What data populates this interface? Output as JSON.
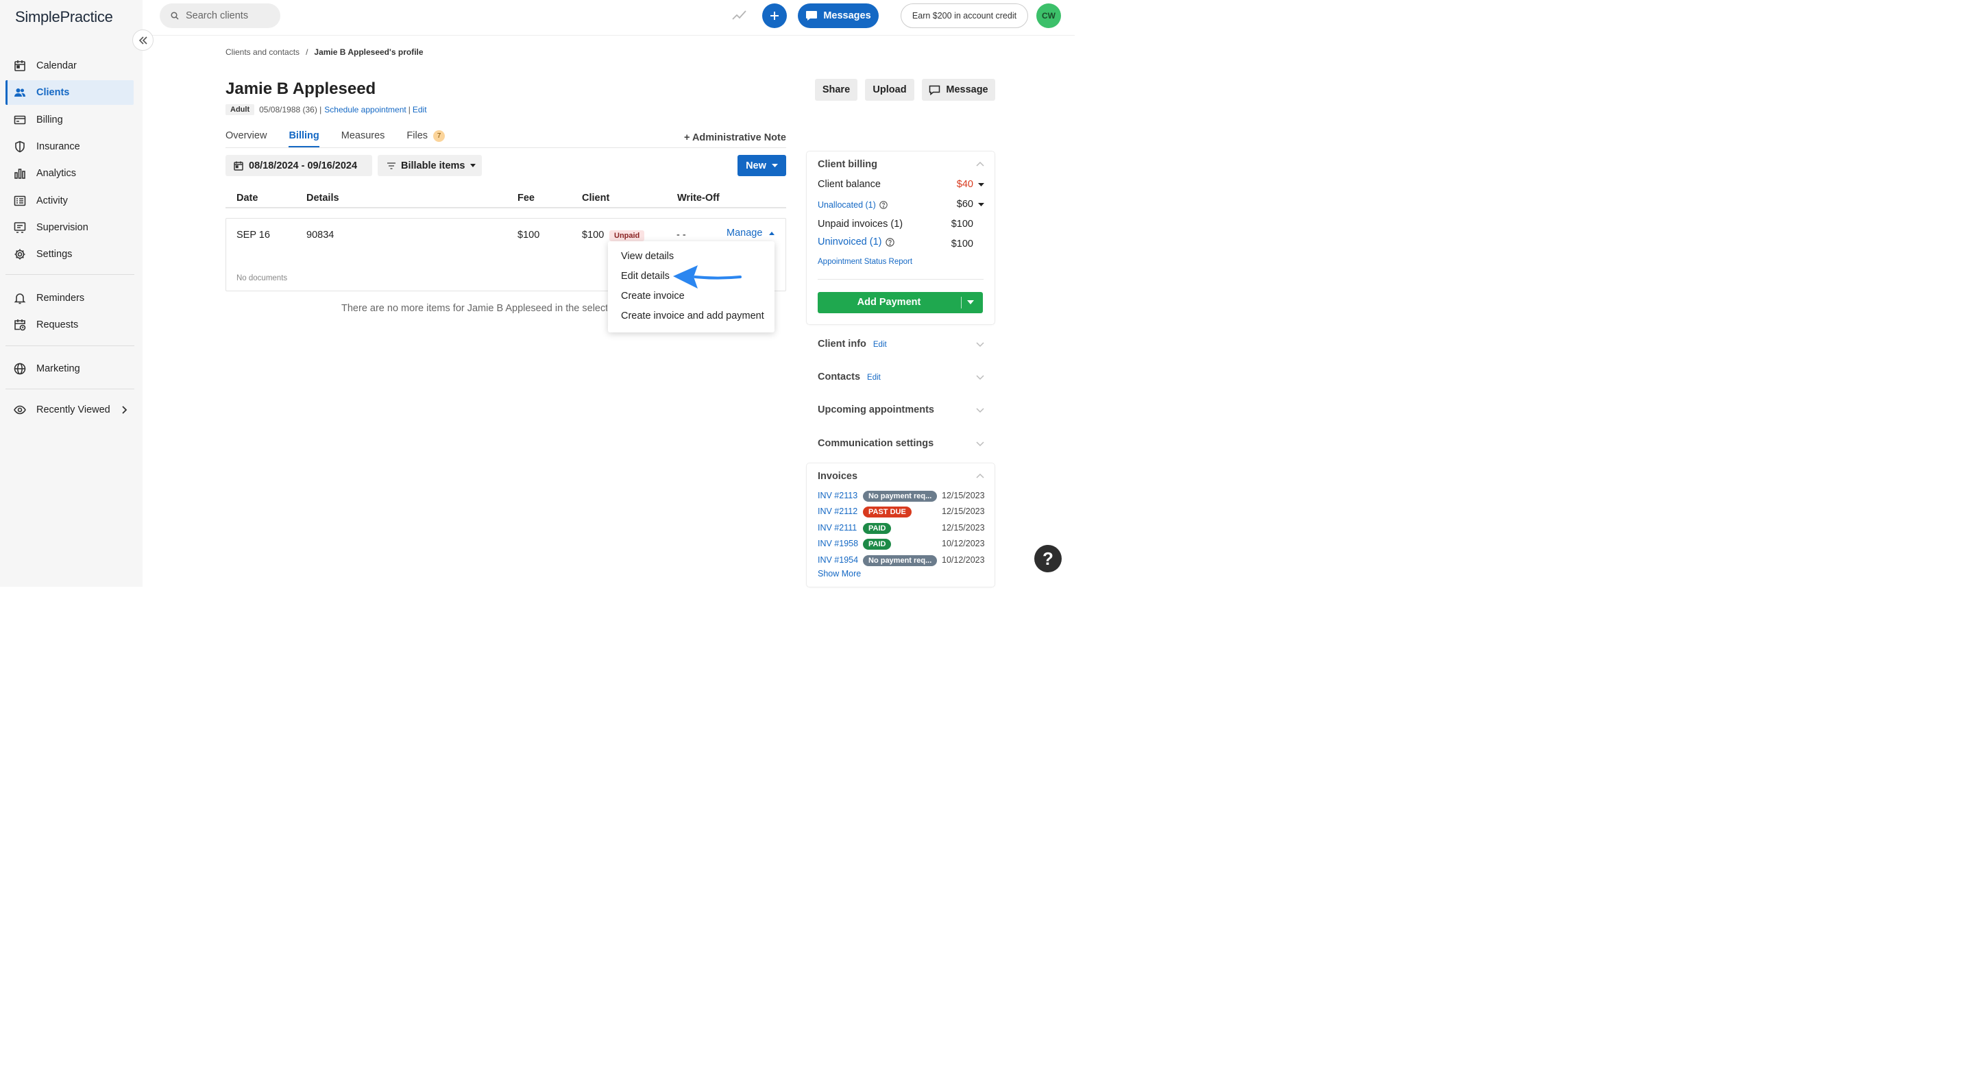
{
  "app": {
    "logo": "SimplePractice"
  },
  "sidebar": {
    "items": [
      {
        "label": "Calendar",
        "icon": "calendar-icon"
      },
      {
        "label": "Clients",
        "icon": "users-icon",
        "active": true
      },
      {
        "label": "Billing",
        "icon": "credit-card-icon"
      },
      {
        "label": "Insurance",
        "icon": "shield-icon"
      },
      {
        "label": "Analytics",
        "icon": "bar-chart-icon"
      },
      {
        "label": "Activity",
        "icon": "list-icon"
      },
      {
        "label": "Supervision",
        "icon": "supervision-icon"
      },
      {
        "label": "Settings",
        "icon": "gear-icon"
      },
      {
        "label": "Reminders",
        "icon": "bell-icon"
      },
      {
        "label": "Requests",
        "icon": "calendar-clock-icon"
      },
      {
        "label": "Marketing",
        "icon": "globe-icon"
      },
      {
        "label": "Recently Viewed",
        "icon": "eye-icon"
      }
    ]
  },
  "topbar": {
    "search_placeholder": "Search clients",
    "messages_label": "Messages",
    "earn_label": "Earn $200 in account credit",
    "avatar_initials": "CW"
  },
  "breadcrumb": {
    "parent": "Clients and contacts",
    "separator": "/",
    "current": "Jamie B Appleseed's profile"
  },
  "client": {
    "name": "Jamie B Appleseed",
    "badge": "Adult",
    "dob": "05/08/1988 (36) |",
    "schedule_link": "Schedule appointment",
    "pipe": "|",
    "edit_link": "Edit"
  },
  "header_actions": {
    "share": "Share",
    "upload": "Upload",
    "message": "Message"
  },
  "tabs": [
    {
      "label": "Overview"
    },
    {
      "label": "Billing",
      "active": true
    },
    {
      "label": "Measures"
    },
    {
      "label": "Files",
      "count": "7"
    }
  ],
  "admin_note": "+ Administrative Note",
  "filters": {
    "date_range": "08/18/2024 - 09/16/2024",
    "billable": "Billable items",
    "new": "New"
  },
  "table": {
    "headers": [
      "Date",
      "Details",
      "Fee",
      "Client",
      "Write-Off"
    ],
    "row": {
      "date": "SEP 16",
      "details": "90834",
      "fee": "$100",
      "client": "$100",
      "status": "Unpaid",
      "writeoff": "- -",
      "manage": "Manage",
      "no_docs": "No documents"
    },
    "no_more": "There are no more items for Jamie B Appleseed in the selected"
  },
  "manage_menu": [
    "View details",
    "Edit details",
    "Create invoice",
    "Create invoice and add payment"
  ],
  "client_billing": {
    "title": "Client billing",
    "balance_label": "Client balance",
    "balance_value": "$40",
    "unallocated_label": "Unallocated (1)",
    "unallocated_value": "$60",
    "unpaid_label": "Unpaid invoices (1)",
    "unpaid_value": "$100",
    "uninvoiced_label": "Uninvoiced (1)",
    "uninvoiced_value": "$100",
    "report_link": "Appointment Status Report",
    "add_payment": "Add Payment"
  },
  "sections": {
    "client_info": "Client info",
    "contacts": "Contacts",
    "upcoming": "Upcoming appointments",
    "communication": "Communication settings",
    "edit": "Edit"
  },
  "invoices": {
    "title": "Invoices",
    "items": [
      {
        "id": "INV #2113",
        "status": "No payment req...",
        "date": "12/15/2023",
        "color": "#6b7c8c"
      },
      {
        "id": "INV #2112",
        "status": "PAST DUE",
        "date": "12/15/2023",
        "color": "#d83a1e"
      },
      {
        "id": "INV #2111",
        "status": "PAID",
        "date": "12/15/2023",
        "color": "#1d8a47"
      },
      {
        "id": "INV #1958",
        "status": "PAID",
        "date": "10/12/2023",
        "color": "#1d8a47"
      },
      {
        "id": "INV #1954",
        "status": "No payment req...",
        "date": "10/12/2023",
        "color": "#6b7c8c"
      }
    ],
    "show_more": "Show More"
  },
  "help": "?",
  "colors": {
    "primary": "#1468c4",
    "success": "#1fa84f",
    "danger": "#d83a1e",
    "balance": "#d83a1e"
  }
}
